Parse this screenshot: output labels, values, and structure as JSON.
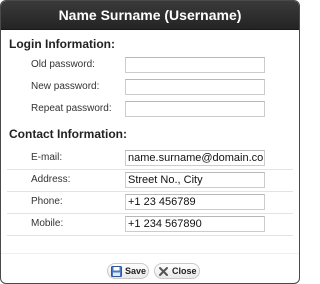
{
  "dialog": {
    "title": "Name Surname (Username)"
  },
  "login": {
    "section_title": "Login Information:",
    "old_password_label": "Old password:",
    "new_password_label": "New password:",
    "repeat_password_label": "Repeat password:",
    "old_password_value": "",
    "new_password_value": "",
    "repeat_password_value": ""
  },
  "contact": {
    "section_title": "Contact Information:",
    "email_label": "E-mail:",
    "email_value": "name.surname@domain.com",
    "address_label": "Address:",
    "address_value": "Street No., City",
    "phone_label": "Phone:",
    "phone_value": "+1 23 456789",
    "mobile_label": "Mobile:",
    "mobile_value": "+1 234 567890"
  },
  "buttons": {
    "save_label": "Save",
    "close_label": "Close",
    "save_icon": "floppy-disk-icon",
    "close_icon": "x-close-icon"
  },
  "colors": {
    "titlebar": "#2f2f2f",
    "border": "#4a4a4a"
  }
}
